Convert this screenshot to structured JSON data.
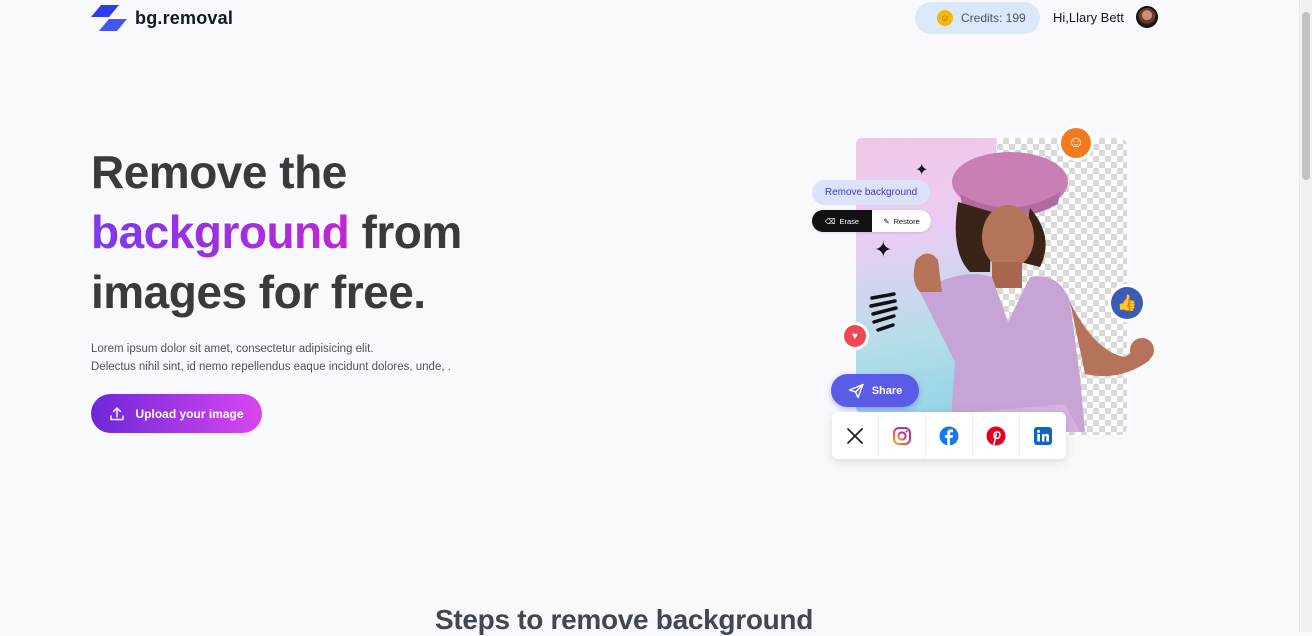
{
  "brand": {
    "name": "bg.removal",
    "logo_icon": "logo-icon",
    "logo_color": "#2b3ee6"
  },
  "header": {
    "credits_label": "Credits: 199",
    "greeting": "Hi,Llary Bett",
    "avatar_icon": "avatar"
  },
  "hero": {
    "title_line1": "Remove the",
    "title_accent": "background",
    "title_after_accent": " from",
    "title_line3": "images for free.",
    "description_line1": "Lorem ipsum dolor sit amet, consectetur adipisicing elit.",
    "description_line2": "Delectus nihil sint, id nemo repellendus eaque incidunt dolores, unde, .",
    "upload_button": "Upload your image",
    "accent_gradient": [
      "#7c3aed",
      "#c026d3"
    ]
  },
  "illustration": {
    "remove_chip": "Remove background",
    "erase_label": "Erase",
    "restore_label": "Restore",
    "share_label": "Share",
    "socials": [
      "x-icon",
      "instagram-icon",
      "facebook-icon",
      "pinterest-icon",
      "linkedin-icon"
    ]
  },
  "sections": {
    "steps_title": "Steps to remove background"
  }
}
